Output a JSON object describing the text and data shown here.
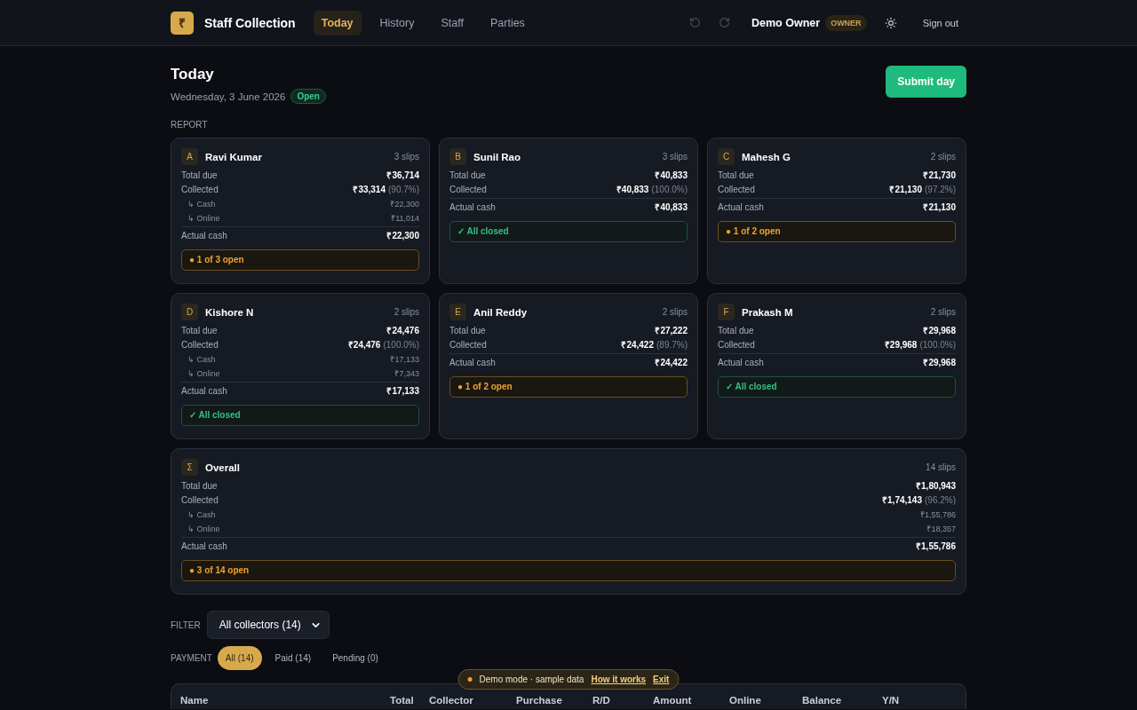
{
  "brand": {
    "logo": "₹",
    "name": "Staff Collection"
  },
  "nav": [
    {
      "label": "Today",
      "selected": true
    },
    {
      "label": "History",
      "selected": false
    },
    {
      "label": "Staff",
      "selected": false
    },
    {
      "label": "Parties",
      "selected": false
    }
  ],
  "user": {
    "name": "Demo Owner",
    "role": "OWNER",
    "sign_out": "Sign out"
  },
  "page": {
    "title": "Today",
    "date": "Wednesday, 3 June 2026",
    "status": "Open",
    "submit": "Submit day"
  },
  "report_label": "REPORT",
  "collectors": [
    {
      "avatar": "A",
      "name": "Ravi Kumar",
      "slips": "3 slips",
      "rows": [
        {
          "kind": "main",
          "label": "Total due",
          "value": "₹36,714"
        },
        {
          "kind": "main",
          "label": "Collected",
          "value": "₹33,314",
          "pct": "(90.7%)"
        },
        {
          "kind": "sub",
          "label": "↳ Cash",
          "value": "₹22,300"
        },
        {
          "kind": "sub",
          "label": "↳ Online",
          "value": "₹11,014"
        }
      ],
      "actual_label": "Actual cash",
      "actual": "₹22,300",
      "status": {
        "kind": "open",
        "text": "● 1 of 3 open"
      }
    },
    {
      "avatar": "B",
      "name": "Sunil Rao",
      "slips": "3 slips",
      "rows": [
        {
          "kind": "main",
          "label": "Total due",
          "value": "₹40,833"
        },
        {
          "kind": "main",
          "label": "Collected",
          "value": "₹40,833",
          "pct": "(100.0%)"
        }
      ],
      "actual_label": "Actual cash",
      "actual": "₹40,833",
      "status": {
        "kind": "closed",
        "text": "✓ All closed"
      }
    },
    {
      "avatar": "C",
      "name": "Mahesh G",
      "slips": "2 slips",
      "rows": [
        {
          "kind": "main",
          "label": "Total due",
          "value": "₹21,730"
        },
        {
          "kind": "main",
          "label": "Collected",
          "value": "₹21,130",
          "pct": "(97.2%)"
        }
      ],
      "actual_label": "Actual cash",
      "actual": "₹21,130",
      "status": {
        "kind": "open",
        "text": "● 1 of 2 open"
      }
    },
    {
      "avatar": "D",
      "name": "Kishore N",
      "slips": "2 slips",
      "rows": [
        {
          "kind": "main",
          "label": "Total due",
          "value": "₹24,476"
        },
        {
          "kind": "main",
          "label": "Collected",
          "value": "₹24,476",
          "pct": "(100.0%)"
        },
        {
          "kind": "sub",
          "label": "↳ Cash",
          "value": "₹17,133"
        },
        {
          "kind": "sub",
          "label": "↳ Online",
          "value": "₹7,343"
        }
      ],
      "actual_label": "Actual cash",
      "actual": "₹17,133",
      "status": {
        "kind": "closed",
        "text": "✓ All closed"
      }
    },
    {
      "avatar": "E",
      "name": "Anil Reddy",
      "slips": "2 slips",
      "rows": [
        {
          "kind": "main",
          "label": "Total due",
          "value": "₹27,222"
        },
        {
          "kind": "main",
          "label": "Collected",
          "value": "₹24,422",
          "pct": "(89.7%)"
        }
      ],
      "actual_label": "Actual cash",
      "actual": "₹24,422",
      "status": {
        "kind": "open",
        "text": "● 1 of 2 open"
      }
    },
    {
      "avatar": "F",
      "name": "Prakash M",
      "slips": "2 slips",
      "rows": [
        {
          "kind": "main",
          "label": "Total due",
          "value": "₹29,968"
        },
        {
          "kind": "main",
          "label": "Collected",
          "value": "₹29,968",
          "pct": "(100.0%)"
        }
      ],
      "actual_label": "Actual cash",
      "actual": "₹29,968",
      "status": {
        "kind": "closed",
        "text": "✓ All closed"
      }
    }
  ],
  "overall": {
    "avatar": "Σ",
    "name": "Overall",
    "slips": "14 slips",
    "rows": [
      {
        "kind": "main",
        "label": "Total due",
        "value": "₹1,80,943"
      },
      {
        "kind": "main",
        "label": "Collected",
        "value": "₹1,74,143",
        "pct": "(96.2%)"
      },
      {
        "kind": "sub",
        "label": "↳ Cash",
        "value": "₹1,55,786"
      },
      {
        "kind": "sub",
        "label": "↳ Online",
        "value": "₹18,357"
      }
    ],
    "actual_label": "Actual cash",
    "actual": "₹1,55,786",
    "status": {
      "kind": "open",
      "text": "● 3 of 14 open"
    }
  },
  "filter": {
    "label": "FILTER",
    "value": "All collectors (14)"
  },
  "payment": {
    "label": "PAYMENT",
    "options": [
      {
        "label": "All (14)",
        "selected": true
      },
      {
        "label": "Paid (14)",
        "selected": false
      },
      {
        "label": "Pending (0)",
        "selected": false
      }
    ]
  },
  "table": {
    "columns": [
      "Name",
      "Total",
      "Collector",
      "Purchase",
      "R/D",
      "Amount",
      "Online",
      "Balance",
      "Y/N"
    ]
  },
  "demo_banner": {
    "text": "Demo mode · sample data",
    "link": "How it works",
    "exit": "Exit"
  }
}
